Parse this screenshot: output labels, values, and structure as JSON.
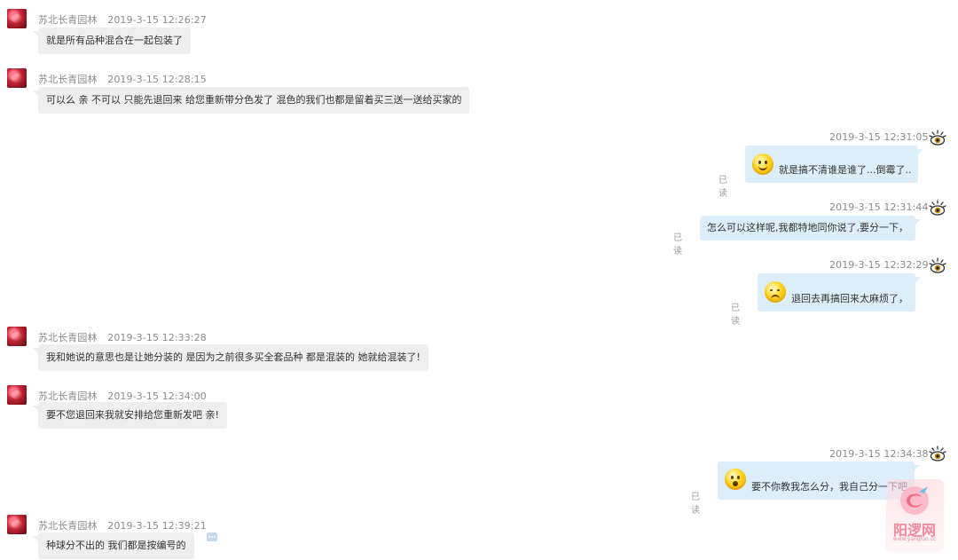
{
  "chat": {
    "messages": [
      {
        "side": "left",
        "name": "苏北长青园林",
        "time": "2019-3-15 12:26:27",
        "text": "就是所有品种混合在一起包装了"
      },
      {
        "side": "left",
        "name": "苏北长青园林",
        "time": "2019-3-15 12:28:15",
        "text": "可以么  亲   不可以  只能先退回来  给您重新带分色发了  混色的我们也都是留着买三送一送给买家的"
      },
      {
        "side": "right",
        "time": "2019-3-15 12:31:05",
        "text": "就是搞不清谁是谁了...倒霉了..",
        "read": "已读",
        "emoji": "smile-emoji"
      },
      {
        "side": "right",
        "time": "2019-3-15 12:31:44",
        "text": "怎么可以这样呢,我都特地同你说了,要分一下，",
        "read": "已读"
      },
      {
        "side": "right",
        "time": "2019-3-15 12:32:29",
        "text": "退回去再搞回来太麻烦了，",
        "read": "已读",
        "emoji": "awkward-emoji"
      },
      {
        "side": "left",
        "name": "苏北长青园林",
        "time": "2019-3-15 12:33:28",
        "text": "我和她说的意思也是让她分装的  是因为之前很多买全套品种 都是混装的  她就给混装了!"
      },
      {
        "side": "left",
        "name": "苏北长青园林",
        "time": "2019-3-15 12:34:00",
        "text": "要不您退回来我就安排给您重新发吧  亲!"
      },
      {
        "side": "right",
        "time": "2019-3-15 12:34:38",
        "text": "要不你教我怎么分，我自己分一下吧",
        "read": "已读",
        "emoji": "surprised-emoji"
      },
      {
        "side": "left",
        "name": "苏北长青园林",
        "time": "2019-3-15 12:39:21",
        "text": "种球分不出的   我们都是按编号的"
      }
    ]
  },
  "watermark": {
    "title": "阳逻网",
    "url": "www.yangluo.cc"
  },
  "colors": {
    "left_bubble": "#eeeeee",
    "right_bubble": "#ddeefb",
    "meta_text": "#8a8a8a"
  }
}
